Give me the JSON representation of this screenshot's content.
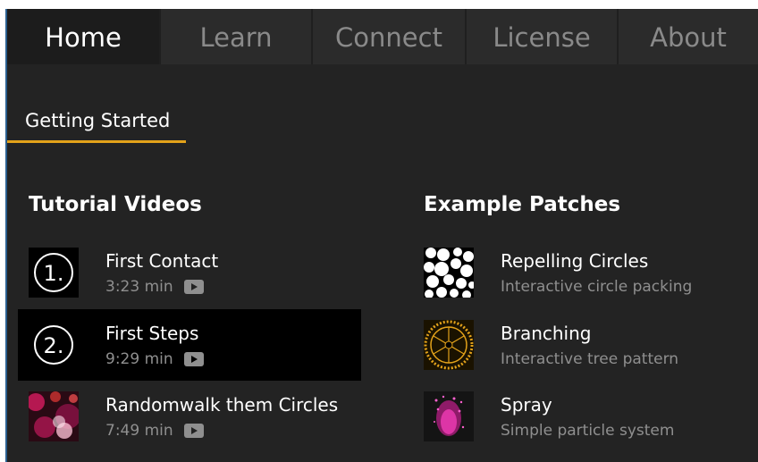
{
  "nav": {
    "tabs": [
      {
        "label": "Home"
      },
      {
        "label": "Learn"
      },
      {
        "label": "Connect"
      },
      {
        "label": "License"
      },
      {
        "label": "About"
      }
    ]
  },
  "subnav": {
    "active_label": "Getting Started"
  },
  "tutorials": {
    "title": "Tutorial Videos",
    "items": [
      {
        "number": "1.",
        "title": "First Contact",
        "duration": "3:23 min"
      },
      {
        "number": "2.",
        "title": "First Steps",
        "duration": "9:29 min"
      },
      {
        "title": "Randomwalk them Circles",
        "duration": "7:49 min"
      }
    ]
  },
  "examples": {
    "title": "Example Patches",
    "items": [
      {
        "title": "Repelling Circles",
        "subtitle": "Interactive circle packing"
      },
      {
        "title": "Branching",
        "subtitle": "Interactive tree pattern"
      },
      {
        "title": "Spray",
        "subtitle": "Simple particle system"
      }
    ]
  },
  "colors": {
    "accent": "#e3a21a",
    "background": "#232323",
    "selected": "#000000"
  },
  "icons": {
    "play": "play-icon"
  }
}
